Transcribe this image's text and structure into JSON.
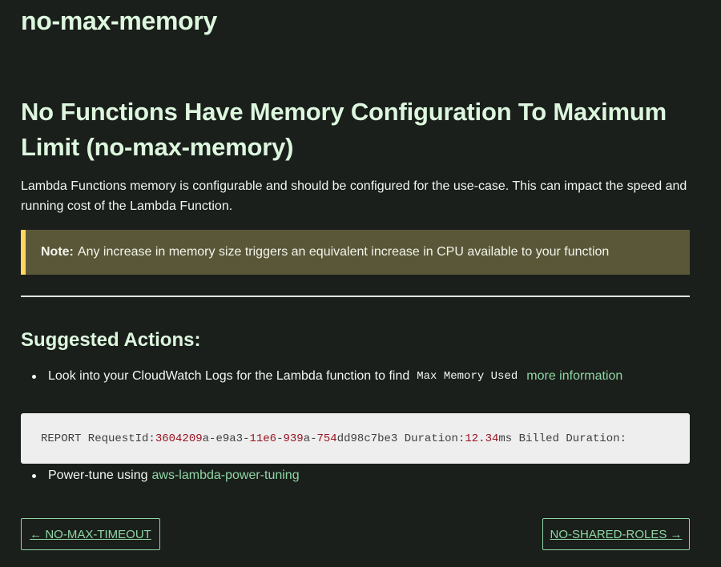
{
  "site": {
    "title": "no-max-memory"
  },
  "page": {
    "title": "No Functions Have Memory Configuration To Maximum Limit (no-max-memory)",
    "description": "Lambda Functions memory is configurable and should be configured for the use-case. This can impact the speed and running cost of the Lambda Function."
  },
  "note": {
    "label": "Note:",
    "text": "Any increase in memory size triggers an equivalent increase in CPU available to your function",
    "accent_color": "#ffd75e",
    "background_color": "#5a5739"
  },
  "actions": {
    "heading": "Suggested Actions:",
    "item1": {
      "text": "Look into your CloudWatch Logs for the Lambda function to find",
      "code": "Max Memory Used",
      "link": "more information"
    },
    "code_block": {
      "parts": [
        {
          "text": "REPORT RequestId: ",
          "type": "plain"
        },
        {
          "text": "3604209",
          "type": "num"
        },
        {
          "text": "a-e9a3-",
          "type": "plain"
        },
        {
          "text": "11e6",
          "type": "num"
        },
        {
          "text": "-",
          "type": "plain"
        },
        {
          "text": "939",
          "type": "num"
        },
        {
          "text": "a-",
          "type": "plain"
        },
        {
          "text": "754",
          "type": "num"
        },
        {
          "text": "dd98c7be3  Duration: ",
          "type": "plain"
        },
        {
          "text": "12.34",
          "type": "num"
        },
        {
          "text": " ms  Billed Duration:",
          "type": "plain"
        }
      ]
    },
    "item2": {
      "text": "Power-tune using",
      "link": "aws-lambda-power-tuning"
    }
  },
  "navigation": {
    "prev_label": "← NO-MAX-TIMEOUT",
    "next_label": "NO-SHARED-ROLES →"
  },
  "colors": {
    "background": "#1b1f1b",
    "heading": "#ddf7df",
    "link": "#8fd6a5",
    "code_number": "#9a1422"
  }
}
